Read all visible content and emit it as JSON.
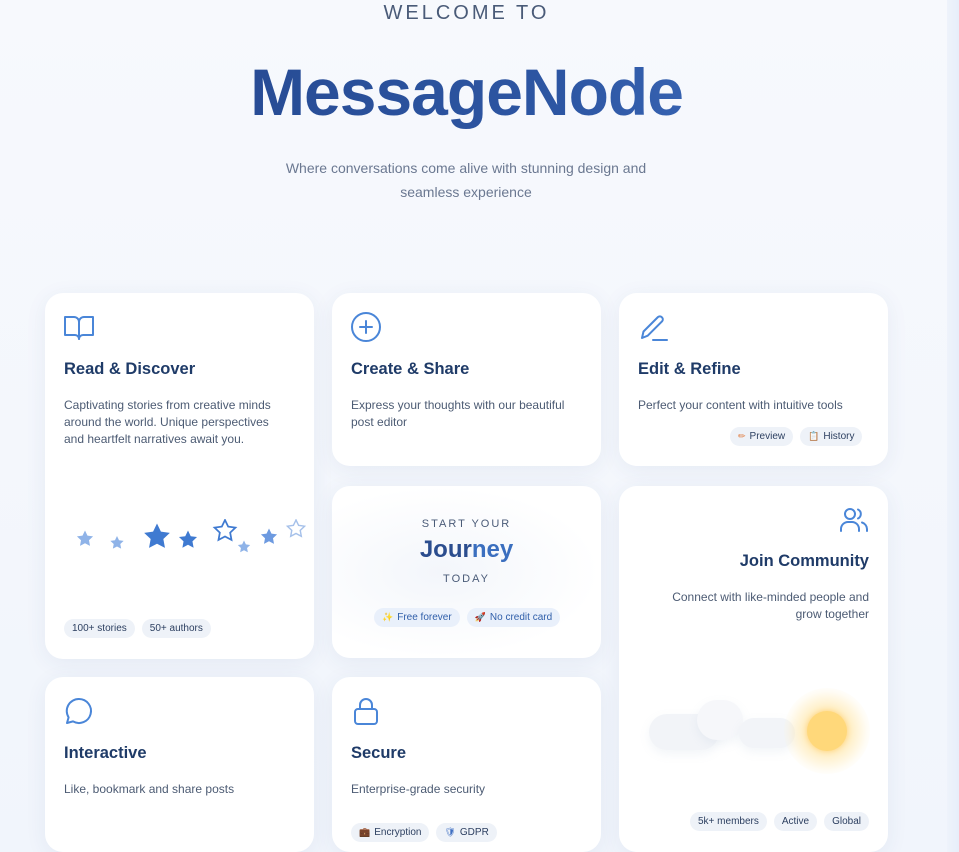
{
  "hero": {
    "eyebrow": "WELCOME TO",
    "title": "MessageNode",
    "subtitle_line1": "Where conversations come alive with stunning design and",
    "subtitle_line2": "seamless experience"
  },
  "colors": {
    "accent": "#3b6fbf",
    "title_dark": "#23448a",
    "text": "#4c5b73",
    "sun": "#ffd87a"
  },
  "cards": {
    "read": {
      "icon": "book-open-icon",
      "title": "Read & Discover",
      "desc1": "Captivating stories from creative minds",
      "desc2": "around the world. Unique perspectives",
      "desc3": "and heartfelt narratives await you.",
      "decoration": "star-icon",
      "pills": [
        "100+ stories",
        "50+ authors"
      ]
    },
    "create": {
      "icon": "plus-circle-icon",
      "title": "Create & Share",
      "desc1": "Express your thoughts with our beautiful",
      "desc2": "post editor"
    },
    "edit": {
      "icon": "pencil-icon",
      "title": "Edit & Refine",
      "desc1": "Perfect your content with intuitive tools",
      "pills": [
        {
          "icon": "pencil-icon",
          "glyph": "✏",
          "label": "Preview"
        },
        {
          "icon": "document-icon",
          "glyph": "📋",
          "label": "History"
        }
      ]
    },
    "journey": {
      "eyebrow": "START YOUR",
      "title_part1": "Jour",
      "title_part2": "ney",
      "sub": "TODAY",
      "pills": [
        {
          "icon": "sparkle-icon",
          "glyph": "✨",
          "label": "Free forever"
        },
        {
          "icon": "rocket-icon",
          "glyph": "🚀",
          "label": "No credit card"
        }
      ]
    },
    "community": {
      "icon": "users-icon",
      "title": "Join Community",
      "desc1": "Connect with like-minded people and",
      "desc2": "grow together",
      "pills": [
        "5k+ members",
        "Active",
        "Global"
      ]
    },
    "interactive": {
      "icon": "chat-bubble-icon",
      "title": "Interactive",
      "desc1": "Like, bookmark and share posts"
    },
    "secure": {
      "icon": "lock-icon",
      "title": "Secure",
      "desc1": "Enterprise-grade security",
      "pills": [
        {
          "icon": "briefcase-icon",
          "glyph": "💼",
          "label": "Encryption"
        },
        {
          "icon": "shield-icon",
          "glyph": "🛡",
          "label": "GDPR"
        }
      ]
    }
  }
}
